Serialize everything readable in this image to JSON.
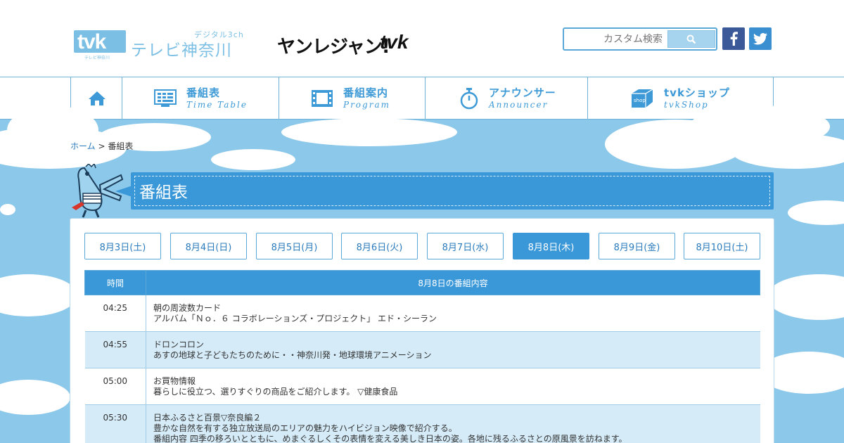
{
  "header": {
    "logo_mark": "tvk",
    "logo_sub": "テレビ神奈川",
    "channel_label": "デジタル3ch",
    "station_name": "テレビ神奈川",
    "brand_left": "ヤンレジャン!",
    "brand_right": "tvk",
    "search_placeholder": "カスタム検索",
    "search_icon": "search-icon"
  },
  "nav": {
    "items": [
      {
        "icon": "home-icon"
      },
      {
        "icon": "timetable-icon",
        "jp": "番組表",
        "en": "Time Table"
      },
      {
        "icon": "film-icon",
        "jp": "番組案内",
        "en": "Program"
      },
      {
        "icon": "stopwatch-icon",
        "jp": "アナウンサー",
        "en": "Announcer"
      },
      {
        "icon": "shop-icon",
        "jp": "tvkショップ",
        "en": "tvkShop"
      }
    ]
  },
  "breadcrumb": {
    "home": "ホーム",
    "separator": ">",
    "current": "番組表"
  },
  "page_title": "番組表",
  "dates": [
    "8月3日(土)",
    "8月4日(日)",
    "8月5日(月)",
    "8月6日(火)",
    "8月7日(水)",
    "8月8日(木)",
    "8月9日(金)",
    "8月10日(土)"
  ],
  "active_date_index": 5,
  "schedule": {
    "headers": {
      "time": "時間",
      "content": "8月8日の番組内容"
    },
    "rows": [
      {
        "time": "04:25",
        "lines": [
          "朝の周波数カード",
          "アルバム「Ｎｏ．６ コラボレーションズ・プロジェクト」 エド・シーラン"
        ]
      },
      {
        "time": "04:55",
        "lines": [
          "ドロンコロン",
          "あすの地球と子どもたちのために・・神奈川発・地球環境アニメーション"
        ]
      },
      {
        "time": "05:00",
        "lines": [
          "お買物情報",
          "暮らしに役立つ、選りすぐりの商品をご紹介します。 ▽健康食品"
        ]
      },
      {
        "time": "05:30",
        "lines": [
          "日本ふるさと百景▽奈良編２",
          "豊かな自然を有する独立放送局のエリアの魅力をハイビジョン映像で紹介する。",
          "番組内容 四季の移ろいとともに、めまぐるしくその表情を変える美しき日本の姿。各地に残るふるさとの原風景を訪ねます。"
        ]
      }
    ]
  },
  "colors": {
    "accent": "#3a98d8",
    "sky": "#8cc8ea",
    "row_alt": "#d5ebf8"
  }
}
